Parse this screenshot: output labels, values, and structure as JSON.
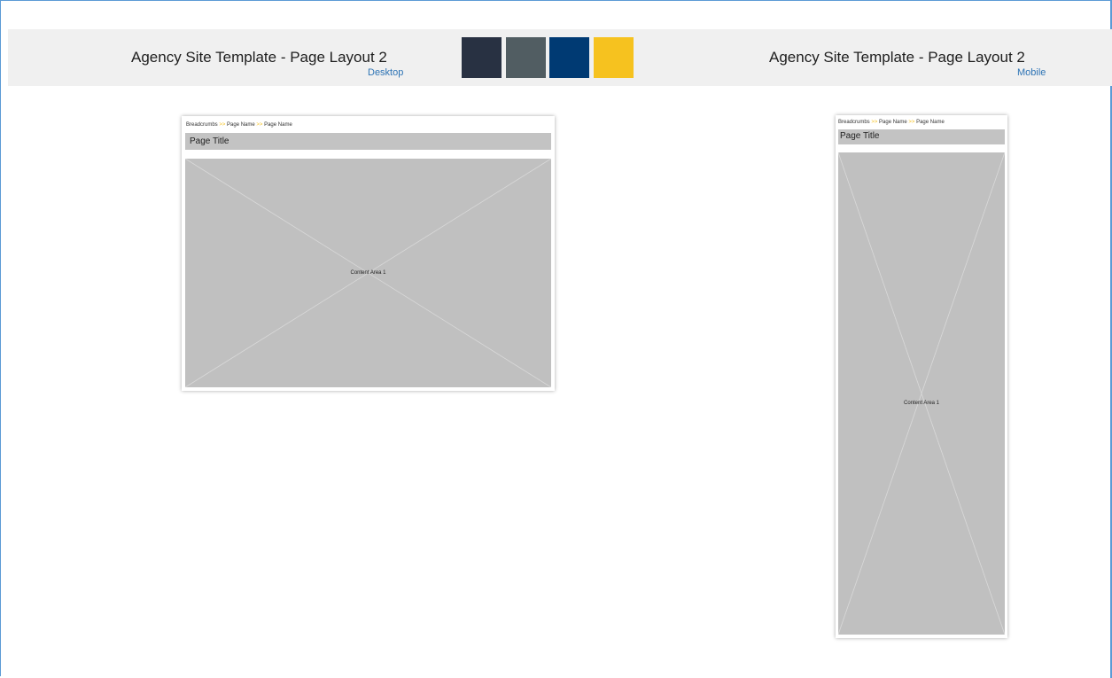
{
  "desktop": {
    "title": "Agency Site Template - Page Layout 2",
    "subtitle": "Desktop",
    "breadcrumbs": [
      "Breadcrumbs",
      "Page Name",
      "Page Name"
    ],
    "breadcrumb_separator": ">>",
    "page_title": "Page Title",
    "content_label": "Content Area 1"
  },
  "mobile": {
    "title": "Agency Site Template  - Page Layout 2",
    "subtitle": "Mobile",
    "breadcrumbs": [
      "Breadcrumbs",
      "Page Name",
      "Page Name"
    ],
    "breadcrumb_separator": ">>",
    "page_title": "Page Title",
    "content_label": "Content Area 1"
  },
  "palette": [
    "#283142",
    "#515d62",
    "#003a73",
    "#f6c21f"
  ],
  "colors": {
    "subtitle_link": "#2e74b5",
    "breadcrumb_separator": "#f6c21f",
    "frame_border": "#5b9bd5",
    "placeholder_fill": "#c0c0c0"
  }
}
